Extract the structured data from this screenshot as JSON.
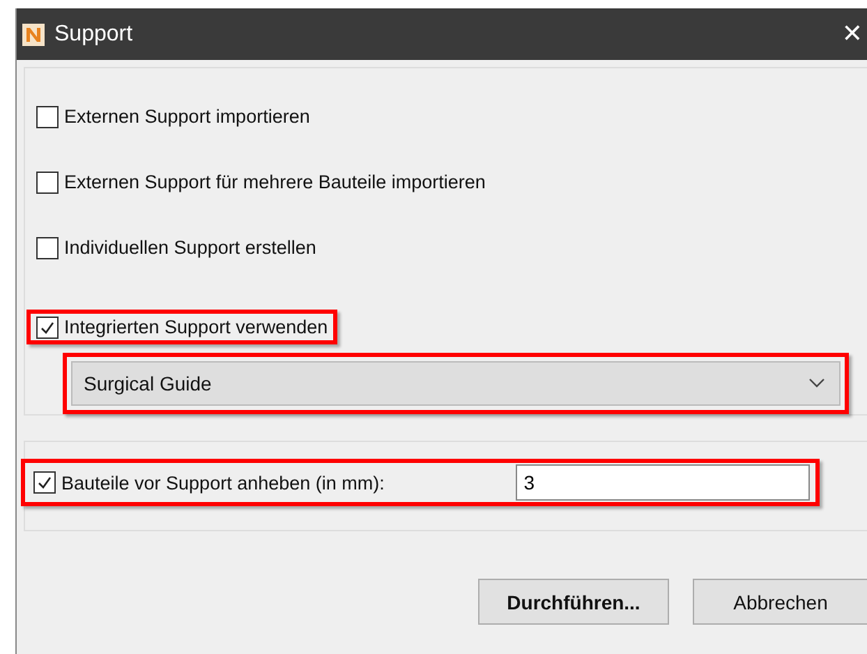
{
  "window": {
    "title": "Support",
    "close": "✕"
  },
  "options": [
    {
      "label": "Externen Support importieren",
      "checked": false,
      "highlighted": false
    },
    {
      "label": "Externen Support für mehrere Bauteile importieren",
      "checked": false,
      "highlighted": false
    },
    {
      "label": "Individuellen Support erstellen",
      "checked": false,
      "highlighted": false
    },
    {
      "label": "Integrierten Support verwenden",
      "checked": true,
      "highlighted": true
    }
  ],
  "dropdown": {
    "value": "Surgical Guide",
    "highlighted": true
  },
  "lift": {
    "label": "Bauteile vor Support anheben (in mm):",
    "checked": true,
    "value": "3",
    "highlighted": true
  },
  "buttons": [
    {
      "label": "Durchführen...",
      "default": true
    },
    {
      "label": "Abbrechen",
      "default": false
    }
  ]
}
